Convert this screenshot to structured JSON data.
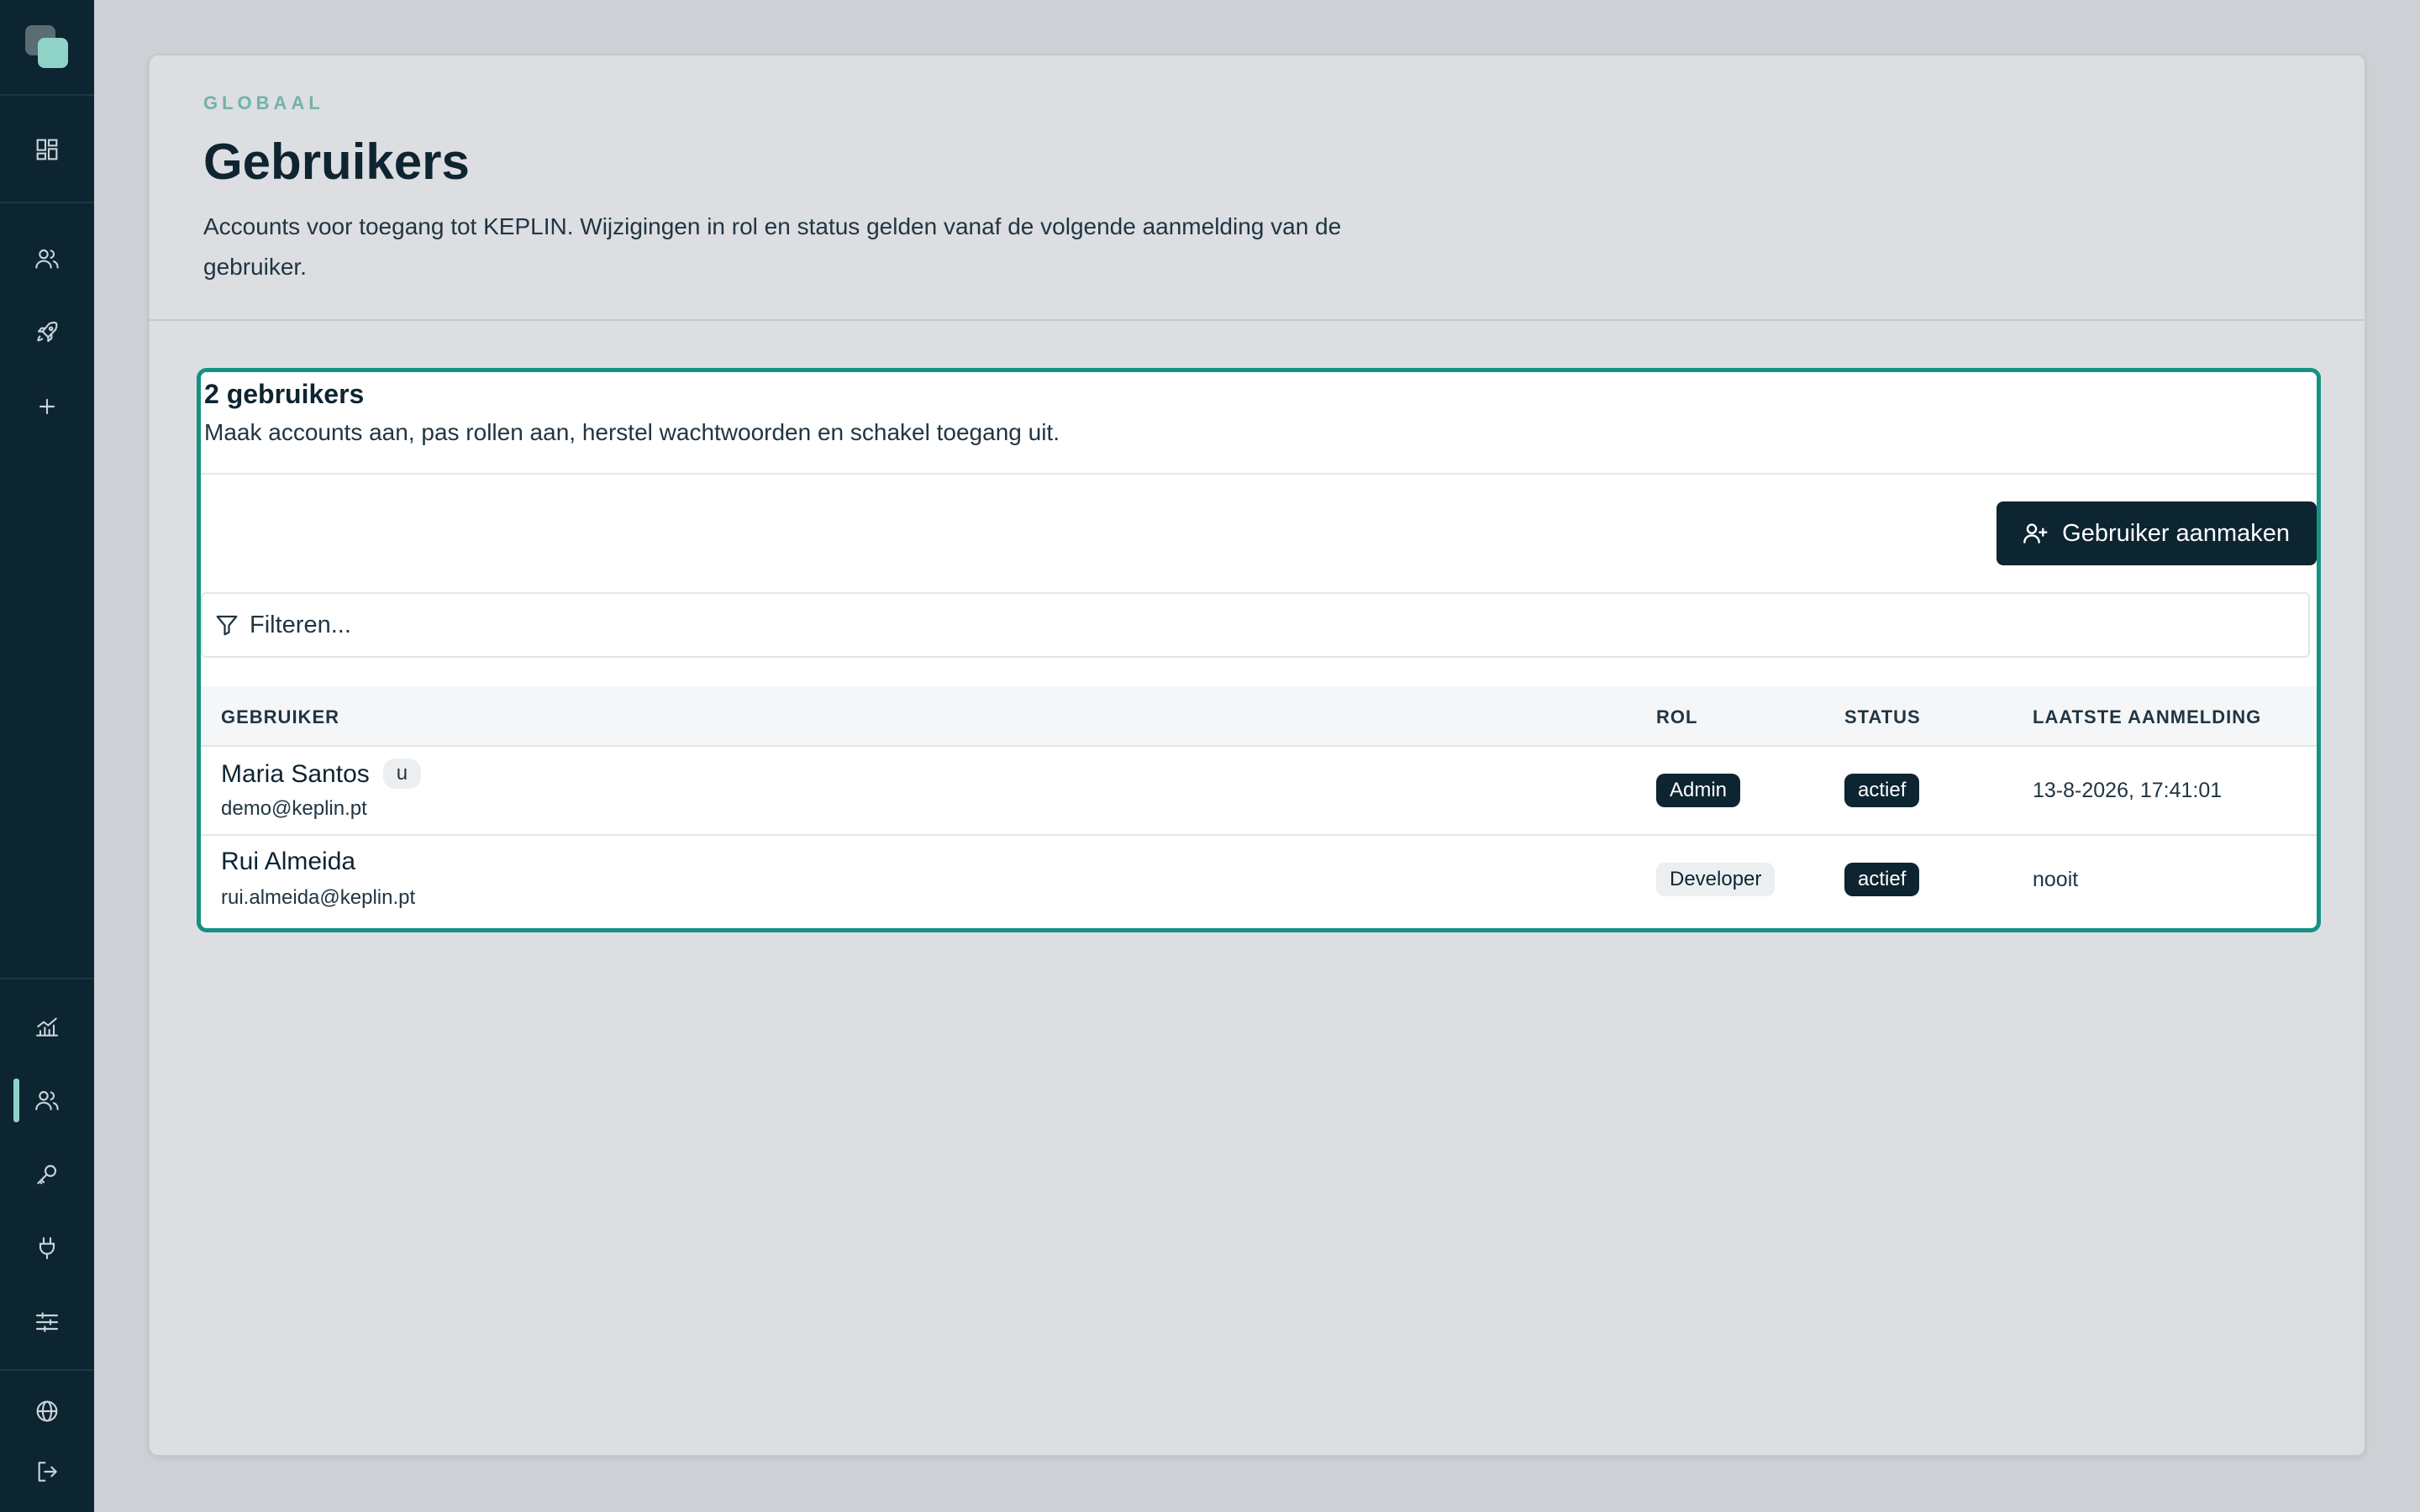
{
  "sidebar": {
    "top_items": [
      {
        "icon": "dashboard-icon"
      },
      {
        "icon": "users-icon"
      },
      {
        "icon": "rocket-icon"
      },
      {
        "icon": "plus-icon"
      }
    ],
    "bottom_items": [
      {
        "icon": "analytics-icon"
      },
      {
        "icon": "users-icon",
        "active": true
      },
      {
        "icon": "key-icon"
      },
      {
        "icon": "plug-icon"
      },
      {
        "icon": "sliders-icon"
      }
    ],
    "footer_items": [
      {
        "icon": "globe-icon"
      },
      {
        "icon": "logout-icon"
      }
    ]
  },
  "header": {
    "eyebrow": "GLOBAAL",
    "title": "Gebruikers",
    "description": "Accounts voor toegang tot KEPLIN. Wijzigingen in rol en status gelden vanaf de volgende aanmelding van de gebruiker."
  },
  "users_card": {
    "title": "2 gebruikers",
    "subtitle": "Maak accounts aan, pas rollen aan, herstel wachtwoorden en schakel toegang uit.",
    "create_button_label": "Gebruiker aanmaken",
    "filter_placeholder": "Filteren...",
    "columns": {
      "user": "GEBRUIKER",
      "role": "ROL",
      "status": "STATUS",
      "last_login": "LAATSTE AANMELDING"
    },
    "rows": [
      {
        "name": "Maria Santos",
        "badge": "u",
        "email": "demo@keplin.pt",
        "role": "Admin",
        "status": "actief",
        "last_login": "13-8-2026, 17:41:01"
      },
      {
        "name": "Rui Almeida",
        "email": "rui.almeida@keplin.pt",
        "role": "Developer",
        "status": "actief",
        "last_login": "nooit"
      }
    ]
  },
  "colors": {
    "sidebar_bg": "#0d2431",
    "accent": "#149383",
    "accent_light": "#8fd2c7",
    "page_bg": "#cdd1d6",
    "panel_bg": "#dcdee2"
  }
}
